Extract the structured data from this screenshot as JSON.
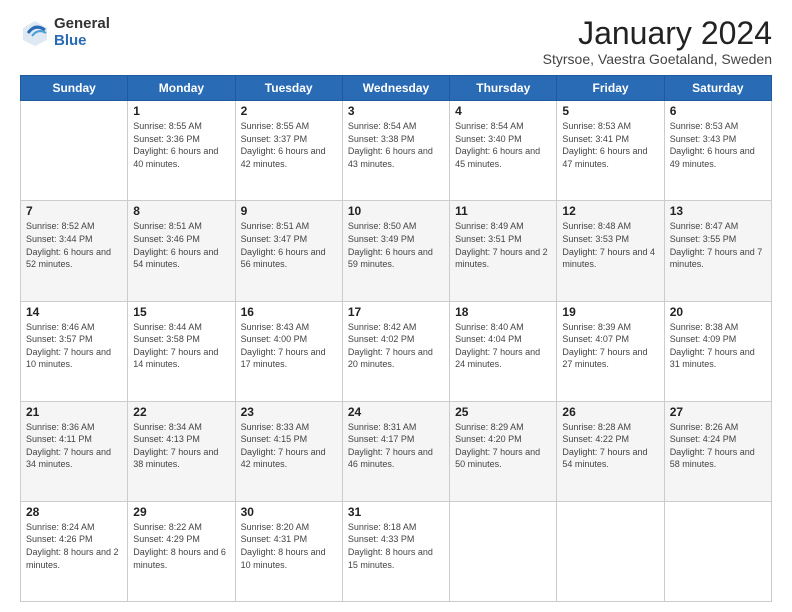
{
  "logo": {
    "general": "General",
    "blue": "Blue"
  },
  "header": {
    "month": "January 2024",
    "location": "Styrsoe, Vaestra Goetaland, Sweden"
  },
  "days": [
    "Sunday",
    "Monday",
    "Tuesday",
    "Wednesday",
    "Thursday",
    "Friday",
    "Saturday"
  ],
  "weeks": [
    [
      {
        "day": "",
        "sunrise": "",
        "sunset": "",
        "daylight": ""
      },
      {
        "day": "1",
        "sunrise": "Sunrise: 8:55 AM",
        "sunset": "Sunset: 3:36 PM",
        "daylight": "Daylight: 6 hours and 40 minutes."
      },
      {
        "day": "2",
        "sunrise": "Sunrise: 8:55 AM",
        "sunset": "Sunset: 3:37 PM",
        "daylight": "Daylight: 6 hours and 42 minutes."
      },
      {
        "day": "3",
        "sunrise": "Sunrise: 8:54 AM",
        "sunset": "Sunset: 3:38 PM",
        "daylight": "Daylight: 6 hours and 43 minutes."
      },
      {
        "day": "4",
        "sunrise": "Sunrise: 8:54 AM",
        "sunset": "Sunset: 3:40 PM",
        "daylight": "Daylight: 6 hours and 45 minutes."
      },
      {
        "day": "5",
        "sunrise": "Sunrise: 8:53 AM",
        "sunset": "Sunset: 3:41 PM",
        "daylight": "Daylight: 6 hours and 47 minutes."
      },
      {
        "day": "6",
        "sunrise": "Sunrise: 8:53 AM",
        "sunset": "Sunset: 3:43 PM",
        "daylight": "Daylight: 6 hours and 49 minutes."
      }
    ],
    [
      {
        "day": "7",
        "sunrise": "Sunrise: 8:52 AM",
        "sunset": "Sunset: 3:44 PM",
        "daylight": "Daylight: 6 hours and 52 minutes."
      },
      {
        "day": "8",
        "sunrise": "Sunrise: 8:51 AM",
        "sunset": "Sunset: 3:46 PM",
        "daylight": "Daylight: 6 hours and 54 minutes."
      },
      {
        "day": "9",
        "sunrise": "Sunrise: 8:51 AM",
        "sunset": "Sunset: 3:47 PM",
        "daylight": "Daylight: 6 hours and 56 minutes."
      },
      {
        "day": "10",
        "sunrise": "Sunrise: 8:50 AM",
        "sunset": "Sunset: 3:49 PM",
        "daylight": "Daylight: 6 hours and 59 minutes."
      },
      {
        "day": "11",
        "sunrise": "Sunrise: 8:49 AM",
        "sunset": "Sunset: 3:51 PM",
        "daylight": "Daylight: 7 hours and 2 minutes."
      },
      {
        "day": "12",
        "sunrise": "Sunrise: 8:48 AM",
        "sunset": "Sunset: 3:53 PM",
        "daylight": "Daylight: 7 hours and 4 minutes."
      },
      {
        "day": "13",
        "sunrise": "Sunrise: 8:47 AM",
        "sunset": "Sunset: 3:55 PM",
        "daylight": "Daylight: 7 hours and 7 minutes."
      }
    ],
    [
      {
        "day": "14",
        "sunrise": "Sunrise: 8:46 AM",
        "sunset": "Sunset: 3:57 PM",
        "daylight": "Daylight: 7 hours and 10 minutes."
      },
      {
        "day": "15",
        "sunrise": "Sunrise: 8:44 AM",
        "sunset": "Sunset: 3:58 PM",
        "daylight": "Daylight: 7 hours and 14 minutes."
      },
      {
        "day": "16",
        "sunrise": "Sunrise: 8:43 AM",
        "sunset": "Sunset: 4:00 PM",
        "daylight": "Daylight: 7 hours and 17 minutes."
      },
      {
        "day": "17",
        "sunrise": "Sunrise: 8:42 AM",
        "sunset": "Sunset: 4:02 PM",
        "daylight": "Daylight: 7 hours and 20 minutes."
      },
      {
        "day": "18",
        "sunrise": "Sunrise: 8:40 AM",
        "sunset": "Sunset: 4:04 PM",
        "daylight": "Daylight: 7 hours and 24 minutes."
      },
      {
        "day": "19",
        "sunrise": "Sunrise: 8:39 AM",
        "sunset": "Sunset: 4:07 PM",
        "daylight": "Daylight: 7 hours and 27 minutes."
      },
      {
        "day": "20",
        "sunrise": "Sunrise: 8:38 AM",
        "sunset": "Sunset: 4:09 PM",
        "daylight": "Daylight: 7 hours and 31 minutes."
      }
    ],
    [
      {
        "day": "21",
        "sunrise": "Sunrise: 8:36 AM",
        "sunset": "Sunset: 4:11 PM",
        "daylight": "Daylight: 7 hours and 34 minutes."
      },
      {
        "day": "22",
        "sunrise": "Sunrise: 8:34 AM",
        "sunset": "Sunset: 4:13 PM",
        "daylight": "Daylight: 7 hours and 38 minutes."
      },
      {
        "day": "23",
        "sunrise": "Sunrise: 8:33 AM",
        "sunset": "Sunset: 4:15 PM",
        "daylight": "Daylight: 7 hours and 42 minutes."
      },
      {
        "day": "24",
        "sunrise": "Sunrise: 8:31 AM",
        "sunset": "Sunset: 4:17 PM",
        "daylight": "Daylight: 7 hours and 46 minutes."
      },
      {
        "day": "25",
        "sunrise": "Sunrise: 8:29 AM",
        "sunset": "Sunset: 4:20 PM",
        "daylight": "Daylight: 7 hours and 50 minutes."
      },
      {
        "day": "26",
        "sunrise": "Sunrise: 8:28 AM",
        "sunset": "Sunset: 4:22 PM",
        "daylight": "Daylight: 7 hours and 54 minutes."
      },
      {
        "day": "27",
        "sunrise": "Sunrise: 8:26 AM",
        "sunset": "Sunset: 4:24 PM",
        "daylight": "Daylight: 7 hours and 58 minutes."
      }
    ],
    [
      {
        "day": "28",
        "sunrise": "Sunrise: 8:24 AM",
        "sunset": "Sunset: 4:26 PM",
        "daylight": "Daylight: 8 hours and 2 minutes."
      },
      {
        "day": "29",
        "sunrise": "Sunrise: 8:22 AM",
        "sunset": "Sunset: 4:29 PM",
        "daylight": "Daylight: 8 hours and 6 minutes."
      },
      {
        "day": "30",
        "sunrise": "Sunrise: 8:20 AM",
        "sunset": "Sunset: 4:31 PM",
        "daylight": "Daylight: 8 hours and 10 minutes."
      },
      {
        "day": "31",
        "sunrise": "Sunrise: 8:18 AM",
        "sunset": "Sunset: 4:33 PM",
        "daylight": "Daylight: 8 hours and 15 minutes."
      },
      {
        "day": "",
        "sunrise": "",
        "sunset": "",
        "daylight": ""
      },
      {
        "day": "",
        "sunrise": "",
        "sunset": "",
        "daylight": ""
      },
      {
        "day": "",
        "sunrise": "",
        "sunset": "",
        "daylight": ""
      }
    ]
  ]
}
